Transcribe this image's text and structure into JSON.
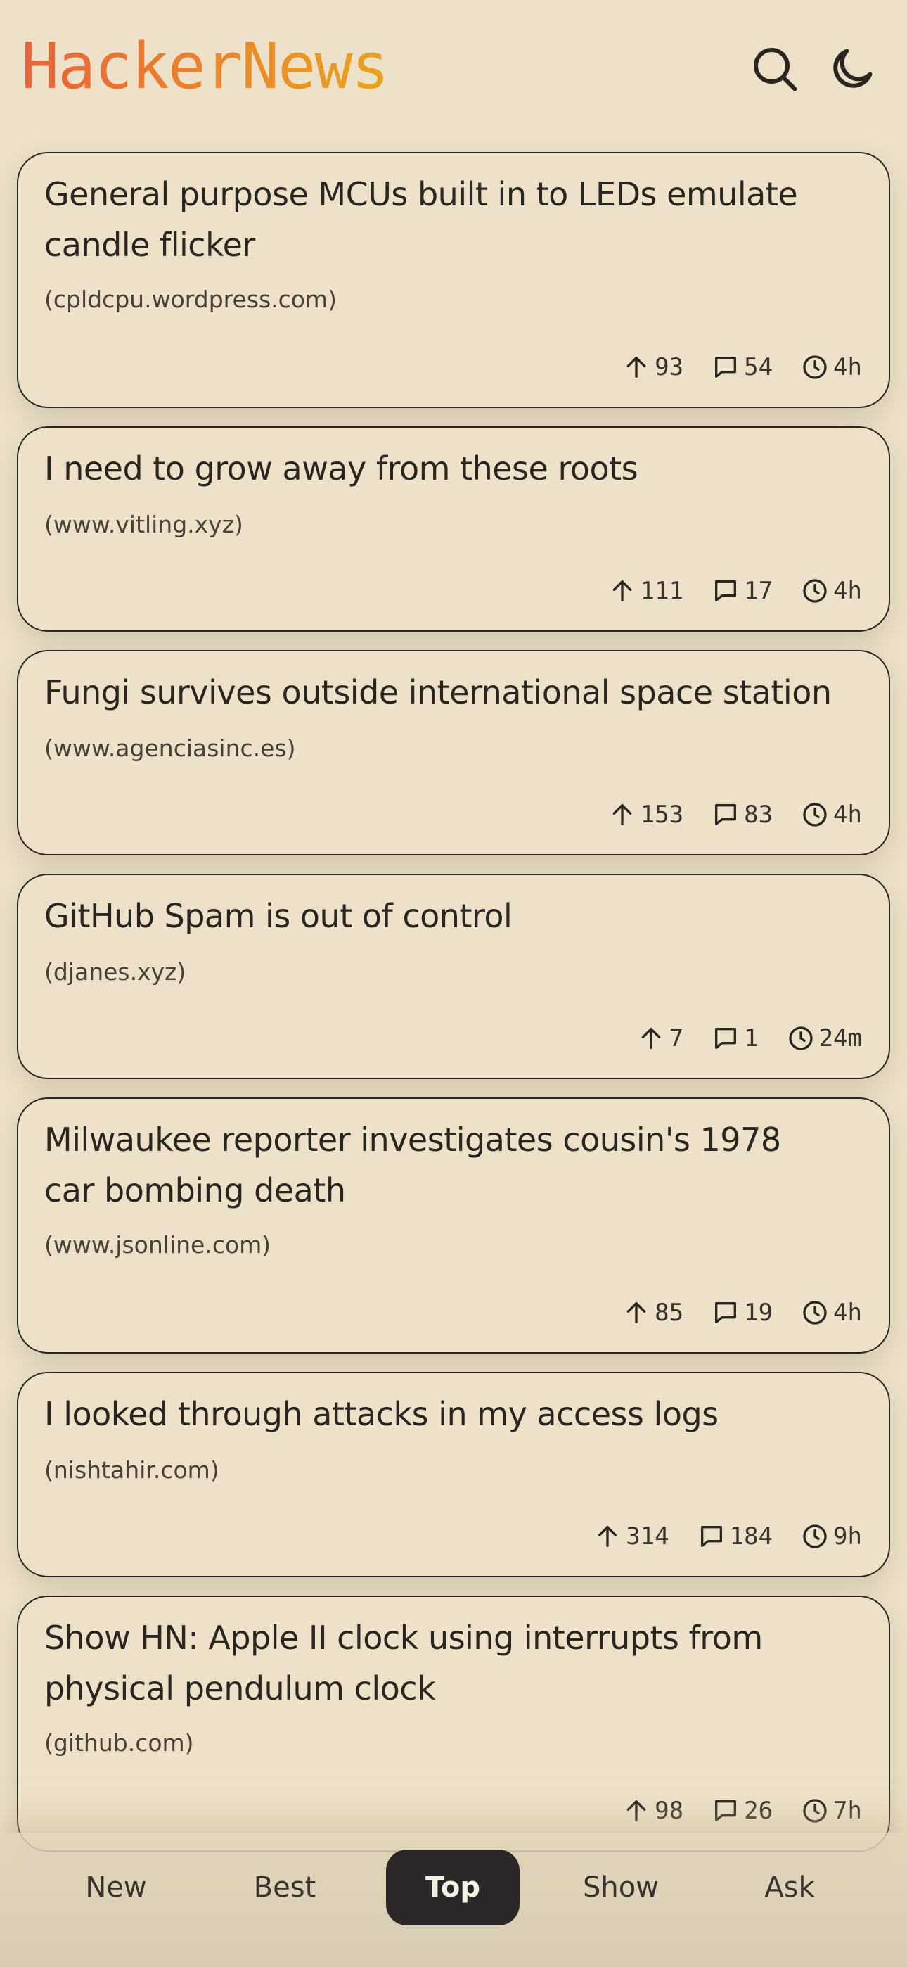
{
  "header": {
    "logo": "HackerNews",
    "search_icon": "search-icon",
    "theme_icon": "moon-icon"
  },
  "stories": [
    {
      "title": "General purpose MCUs built in to LEDs emulate candle flicker",
      "domain": "(cpldcpu.wordpress.com)",
      "points": "93",
      "comments": "54",
      "age": "4h"
    },
    {
      "title": "I need to grow away from these roots",
      "domain": "(www.vitling.xyz)",
      "points": "111",
      "comments": "17",
      "age": "4h"
    },
    {
      "title": "Fungi survives outside international space station",
      "domain": "(www.agenciasinc.es)",
      "points": "153",
      "comments": "83",
      "age": "4h"
    },
    {
      "title": "GitHub Spam is out of control",
      "domain": "(djanes.xyz)",
      "points": "7",
      "comments": "1",
      "age": "24m"
    },
    {
      "title": "Milwaukee reporter investigates cousin's 1978 car bombing death",
      "domain": "(www.jsonline.com)",
      "points": "85",
      "comments": "19",
      "age": "4h"
    },
    {
      "title": "I looked through attacks in my access logs",
      "domain": "(nishtahir.com)",
      "points": "314",
      "comments": "184",
      "age": "9h"
    },
    {
      "title": "Show HN: Apple II clock using interrupts from physical pendulum clock",
      "domain": "(github.com)",
      "points": "98",
      "comments": "26",
      "age": "7h"
    }
  ],
  "tabs": [
    {
      "label": "New",
      "active": false
    },
    {
      "label": "Best",
      "active": false
    },
    {
      "label": "Top",
      "active": true
    },
    {
      "label": "Show",
      "active": false
    },
    {
      "label": "Ask",
      "active": false
    }
  ],
  "colors": {
    "background": "#ede2c9",
    "logo_gradient_start": "#e8643a",
    "logo_gradient_end": "#e9a41e",
    "active_tab": "#2b2729"
  }
}
